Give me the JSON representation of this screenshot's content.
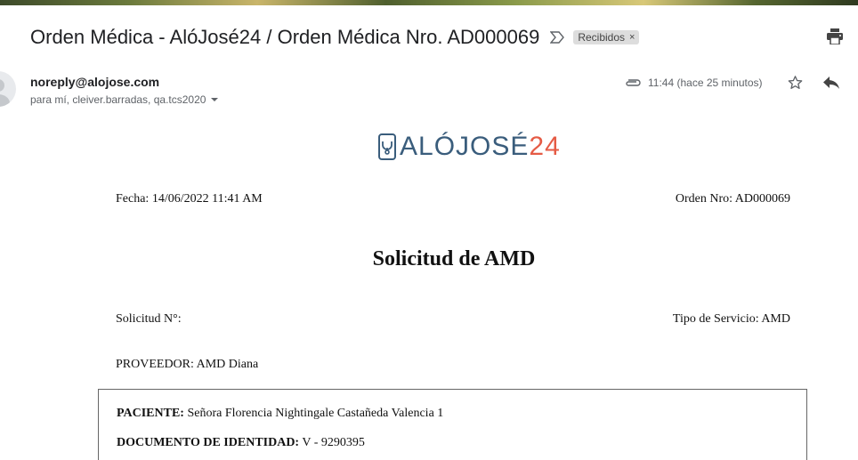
{
  "email": {
    "subject": "Orden Médica - AlóJosé24 / Orden Médica Nro. AD000069",
    "label": "Recibidos",
    "label_remove": "×",
    "sender": "noreply@alojose.com",
    "recipients": "para mí, cleiver.barradas, qa.tcs2020",
    "time": "11:44 (hace 25 minutos)"
  },
  "icons": {
    "important": "important-marker-icon",
    "print": "print-icon",
    "attachment": "paperclip-icon",
    "star": "star-icon",
    "reply": "reply-icon",
    "avatar": "avatar-icon"
  },
  "logo": {
    "text": "ALÓJOSÉ",
    "number": "24",
    "colors": {
      "text": "#3a5d7c",
      "number": "#e55b45"
    }
  },
  "document": {
    "fecha": "Fecha: 14/06/2022 11:41 AM",
    "orden_nro": "Orden Nro: AD000069",
    "title": "Solicitud de AMD",
    "solicitud": "Solicitud N°:",
    "tipo_servicio": "Tipo de Servicio: AMD",
    "proveedor": "PROVEEDOR: AMD Diana",
    "paciente_label": "PACIENTE:",
    "paciente_value": "Señora Florencia Nightingale Castañeda Valencia 1",
    "documento_label": "DOCUMENTO DE IDENTIDAD:",
    "documento_value": "V - 9290395"
  }
}
